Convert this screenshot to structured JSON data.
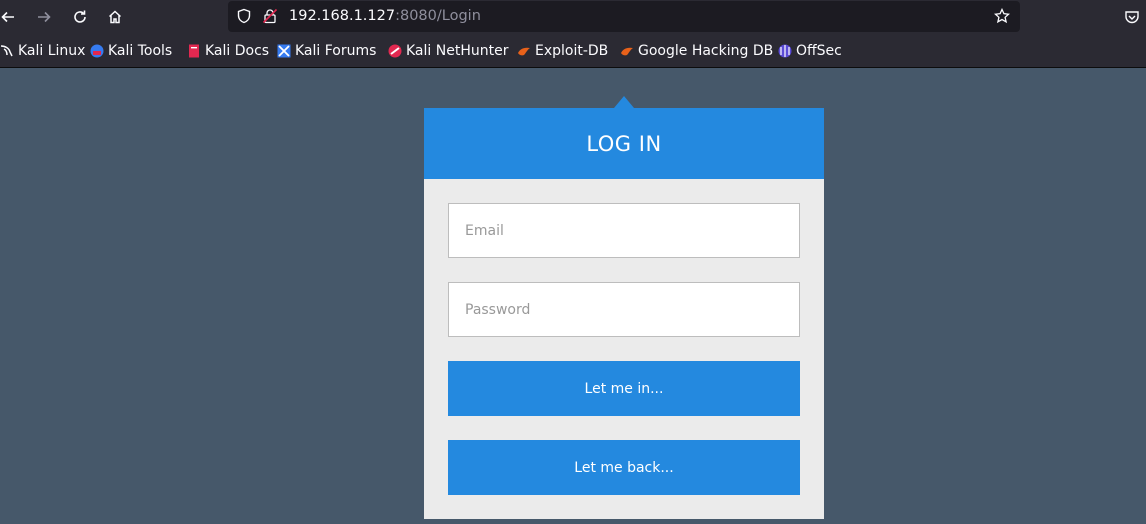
{
  "browser": {
    "url_host": "192.168.1.127",
    "url_rest": ":8080/Login",
    "bookmarks": [
      {
        "label": "Kali Linux",
        "icon": "kali-dragon-icon"
      },
      {
        "label": "Kali Tools",
        "icon": "kali-tools-icon"
      },
      {
        "label": "Kali Docs",
        "icon": "kali-docs-icon"
      },
      {
        "label": "Kali Forums",
        "icon": "kali-forums-icon"
      },
      {
        "label": "Kali NetHunter",
        "icon": "kali-nethunter-icon"
      },
      {
        "label": "Exploit-DB",
        "icon": "exploit-db-icon"
      },
      {
        "label": "Google Hacking DB",
        "icon": "google-hacking-db-icon"
      },
      {
        "label": "OffSec",
        "icon": "offsec-icon"
      }
    ]
  },
  "login": {
    "title": "LOG IN",
    "email_placeholder": "Email",
    "password_placeholder": "Password",
    "submit_label": "Let me in...",
    "back_label": "Let me back..."
  },
  "colors": {
    "page_background": "#46586a",
    "accent": "#2489df",
    "card_background": "#ebebeb"
  }
}
